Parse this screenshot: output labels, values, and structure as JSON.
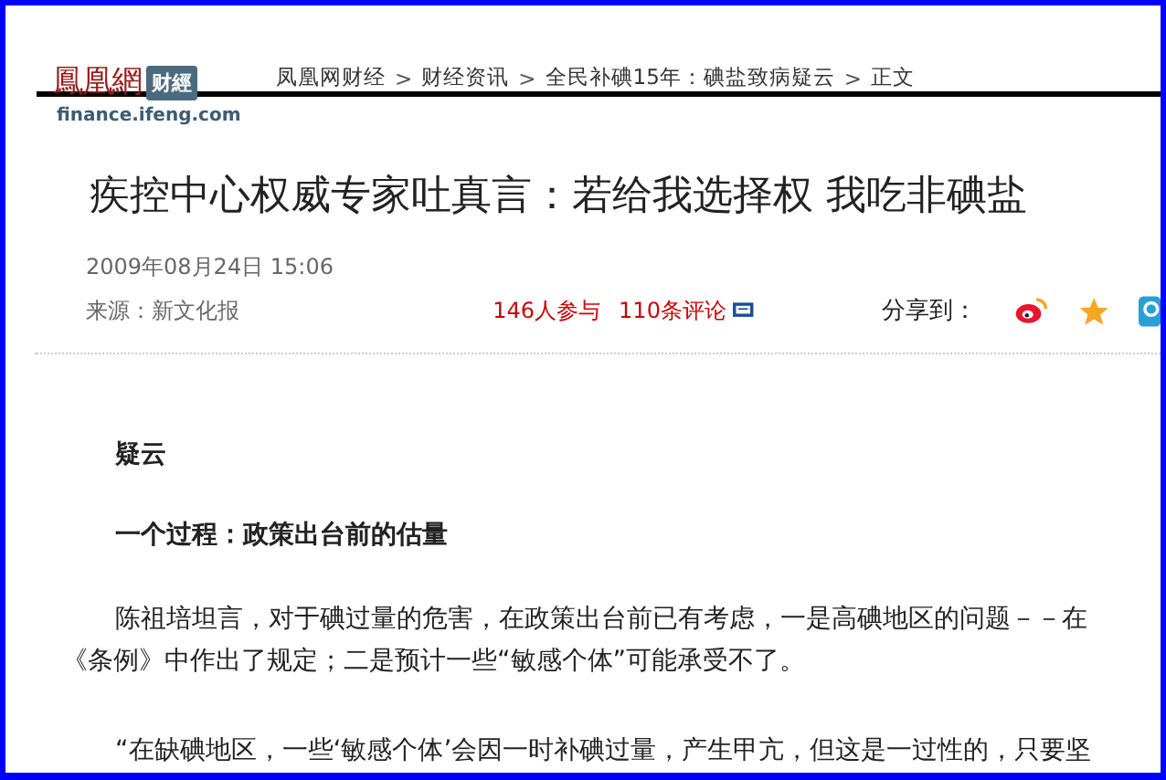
{
  "logo": {
    "name": "鳳凰網",
    "badge": "财經",
    "domain": "finance.ifeng.com"
  },
  "breadcrumb": [
    "凤凰网财经",
    "财经资讯",
    "全民补碘15年：碘盐致病疑云",
    "正文"
  ],
  "breadcrumb_separator": ">",
  "article": {
    "title": "疾控中心权威专家吐真言：若给我选择权 我吃非碘盐",
    "date": "2009年08月24日 15:06",
    "source": "来源：新文化报",
    "participants": "146人参与",
    "comments": "110条评论",
    "share_label": "分享到："
  },
  "body": [
    {
      "kind": "heading",
      "text": "疑云"
    },
    {
      "kind": "heading",
      "text": "一个过程：政策出台前的估量"
    },
    {
      "kind": "paragraph",
      "text": "陈祖培坦言，对于碘过量的危害，在政策出台前已有考虑，一是高碘地区的问题－－在《条例》中作出了规定；二是预计一些“敏感个体”可能承受不了。"
    },
    {
      "kind": "paragraph",
      "text": "“在缺碘地区，一些‘敏感个体’会因一时补碘过量，产生甲亢，但这是一过性的，只要坚"
    }
  ]
}
